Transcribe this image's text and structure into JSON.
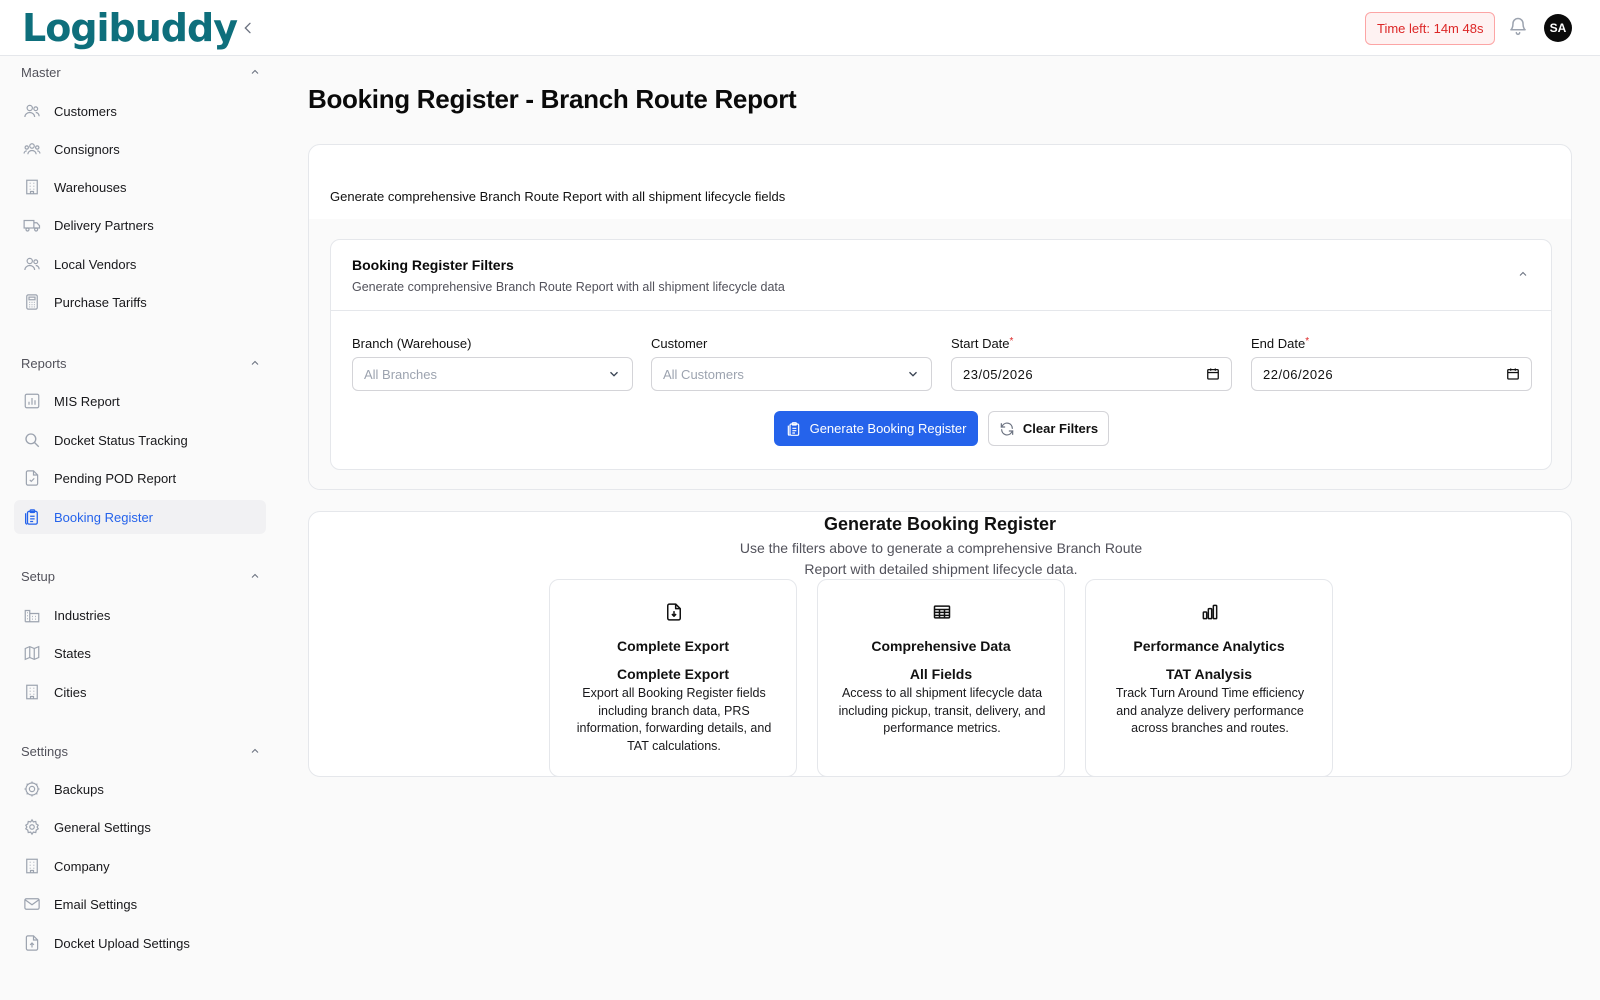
{
  "app": {
    "logo": "Logibuddy",
    "timer": "Time left: 14m 48s",
    "avatar_initials": "SA",
    "accent": "#2563eb",
    "timer_color": "#dc2626"
  },
  "sidebar": {
    "sections": [
      {
        "title": "Master",
        "items": [
          {
            "label": "Customers",
            "icon": "users-icon"
          },
          {
            "label": "Consignors",
            "icon": "group-icon"
          },
          {
            "label": "Warehouses",
            "icon": "building-icon"
          },
          {
            "label": "Delivery Partners",
            "icon": "truck-icon"
          },
          {
            "label": "Local Vendors",
            "icon": "users-icon"
          },
          {
            "label": "Purchase Tariffs",
            "icon": "calculator-icon"
          }
        ]
      },
      {
        "title": "Reports",
        "items": [
          {
            "label": "MIS Report",
            "icon": "chart-icon"
          },
          {
            "label": "Docket Status Tracking",
            "icon": "search-icon"
          },
          {
            "label": "Pending POD Report",
            "icon": "file-check-icon"
          },
          {
            "label": "Booking Register",
            "icon": "clipboard-icon",
            "active": true
          }
        ]
      },
      {
        "title": "Setup",
        "items": [
          {
            "label": "Industries",
            "icon": "factory-icon"
          },
          {
            "label": "States",
            "icon": "map-icon"
          },
          {
            "label": "Cities",
            "icon": "building-icon"
          }
        ]
      },
      {
        "title": "Settings",
        "items": [
          {
            "label": "Backups",
            "icon": "cog-icon"
          },
          {
            "label": "General Settings",
            "icon": "gear-icon"
          },
          {
            "label": "Company",
            "icon": "building-icon"
          },
          {
            "label": "Email Settings",
            "icon": "mail-icon"
          },
          {
            "label": "Docket Upload Settings",
            "icon": "file-upload-icon"
          }
        ]
      }
    ]
  },
  "main": {
    "title": "Booking Register - Branch Route Report",
    "description": "Generate comprehensive Branch Route Report with all shipment lifecycle fields",
    "filters": {
      "title": "Booking Register Filters",
      "subtitle": "Generate comprehensive Branch Route Report with all shipment lifecycle data",
      "branch_label": "Branch (Warehouse)",
      "branch_placeholder": "All Branches",
      "customer_label": "Customer",
      "customer_placeholder": "All Customers",
      "start_label": "Start Date",
      "start_value": "23/05/2026",
      "end_label": "End Date",
      "end_value": "22/06/2026",
      "required_mark": "*",
      "generate_label": "Generate Booking Register",
      "clear_label": "Clear Filters"
    },
    "empty": {
      "title": "Generate Booking Register",
      "subtitle": "Use the filters above to generate a comprehensive Branch Route Report with detailed shipment lifecycle data.",
      "features": [
        {
          "icon": "file-download-icon",
          "title": "Complete Export",
          "subtitle": "Complete Export",
          "desc": "Export all Booking Register fields including branch data, PRS information, forwarding details, and TAT calculations."
        },
        {
          "icon": "table-icon",
          "title": "Comprehensive Data",
          "subtitle": "All Fields",
          "desc": "Access to all shipment lifecycle data including pickup, transit, delivery, and performance metrics."
        },
        {
          "icon": "bar-chart-icon",
          "title": "Performance Analytics",
          "subtitle": "TAT Analysis",
          "desc": "Track Turn Around Time efficiency and analyze delivery performance across branches and routes."
        }
      ]
    }
  }
}
